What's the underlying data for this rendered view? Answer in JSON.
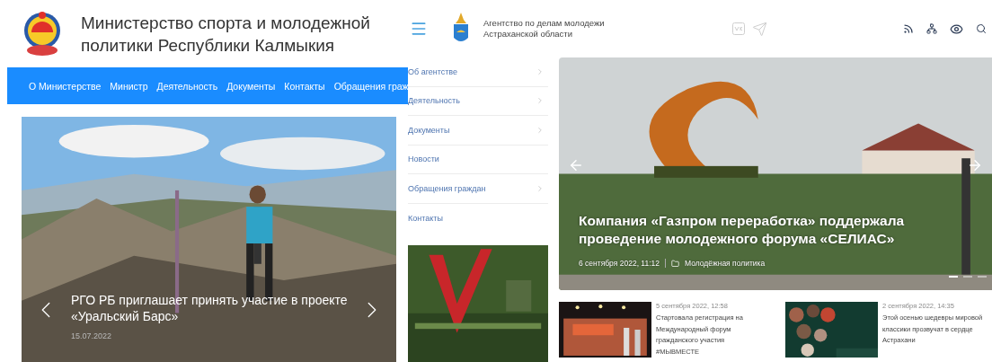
{
  "kalmykia_site": {
    "title_lines": [
      "Министерство спорта и молодежной",
      "политики Республики Калмыкия"
    ],
    "nav": [
      "О Министерстве",
      "Министр",
      "Деятельность",
      "Документы",
      "Контакты",
      "Обращения граж"
    ],
    "slider": {
      "caption": "РГО РБ приглашает принять участие в проекте «Уральский Барс»",
      "date": "15.07.2022"
    }
  },
  "astrakhan_site": {
    "title_lines": [
      "Агентство по делам молодежи",
      "Астраханской области"
    ],
    "sidebar": [
      {
        "label": "Об агентстве",
        "has_children": true
      },
      {
        "label": "Деятельность",
        "has_children": true
      },
      {
        "label": "Документы",
        "has_children": true
      },
      {
        "label": "Новости",
        "has_children": false
      },
      {
        "label": "Обращения граждан",
        "has_children": true
      },
      {
        "label": "Контакты",
        "has_children": false
      }
    ],
    "slider": {
      "title": "Компания «Газпром переработка» поддержала проведение молодежного форума «СЕЛИАС»",
      "date": "6 сентября 2022, 11:12",
      "category": "Молодёжная политика",
      "dots": [
        {
          "selected": true
        },
        {
          "selected": false
        },
        {
          "selected": false
        }
      ]
    },
    "news": [
      {
        "date": "5 сентября 2022, 12:58",
        "title": "Стартовала регистрация на Международный форум гражданского участия #МЫВМЕСТЕ",
        "kind": "stage"
      },
      {
        "date": "2 сентября 2022, 14:35",
        "title": "Этой осенью шедевры мировой классики прозвучат в сердце Астрахани",
        "kind": "poster"
      }
    ]
  }
}
